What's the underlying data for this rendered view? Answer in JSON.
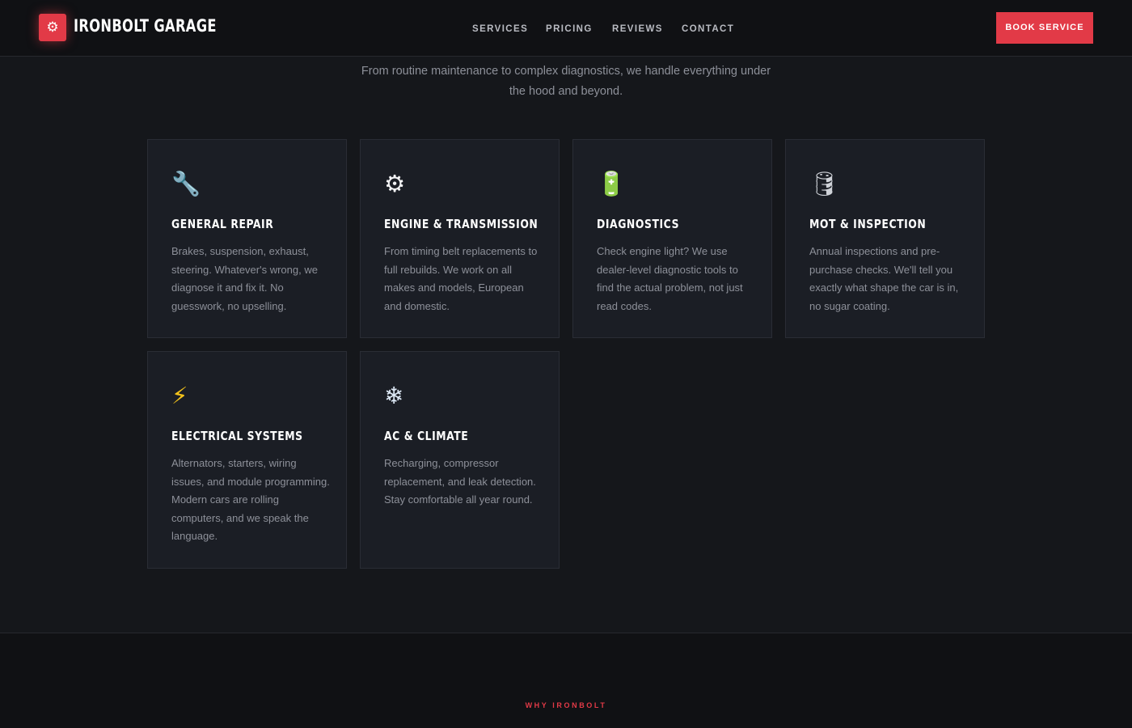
{
  "header": {
    "logo_icon": "gear-icon",
    "logo_glyph": "⚙",
    "brand": "IRONBOLT GARAGE",
    "nav": [
      "SERVICES",
      "PRICING",
      "REVIEWS",
      "CONTACT"
    ],
    "cta": "BOOK SERVICE"
  },
  "services": {
    "intro": "From routine maintenance to complex diagnostics, we handle everything under the hood and beyond.",
    "cards": [
      {
        "icon": "wrench-icon",
        "glyph": "🔧",
        "title": "GENERAL REPAIR",
        "description": "Brakes, suspension, exhaust, steering. Whatever's wrong, we diagnose it and fix it. No guesswork, no upselling."
      },
      {
        "icon": "gear-icon",
        "glyph": "⚙",
        "title": "ENGINE & TRANSMISSION",
        "description": "From timing belt replacements to full rebuilds. We work on all makes and models, European and domestic."
      },
      {
        "icon": "battery-icon",
        "glyph": "🔋",
        "title": "DIAGNOSTICS",
        "description": "Check engine light? We use dealer-level diagnostic tools to find the actual problem, not just read codes."
      },
      {
        "icon": "oil-drum-icon",
        "glyph": "🛢",
        "title": "MOT & INSPECTION",
        "description": "Annual inspections and pre-purchase checks. We'll tell you exactly what shape the car is in, no sugar coating."
      },
      {
        "icon": "lightning-icon",
        "glyph": "⚡",
        "title": "ELECTRICAL SYSTEMS",
        "description": "Alternators, starters, wiring issues, and module programming. Modern cars are rolling computers, and we speak the language."
      },
      {
        "icon": "snowflake-icon",
        "glyph": "❄",
        "title": "AC & CLIMATE",
        "description": "Recharging, compressor replacement, and leak detection. Stay comfortable all year round."
      }
    ]
  },
  "why": {
    "label": "WHY IRONBOLT"
  },
  "colors": {
    "accent": "#e23a47",
    "background": "#15171b",
    "card": "#1b1e25"
  }
}
